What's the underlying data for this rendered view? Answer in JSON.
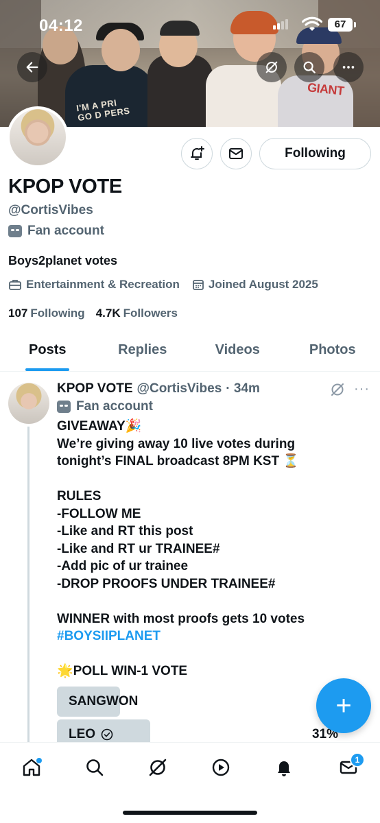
{
  "status_bar": {
    "time": "04:12",
    "battery": "67"
  },
  "banner": {
    "shirt_text": "I'M A PRI\nGO D PERS",
    "shirt_text_right": "GIANT"
  },
  "profile": {
    "name": "KPOP VOTE",
    "handle": "@CortisVibes",
    "label": "Fan account",
    "bio": "Boys2planet votes",
    "category": "Entertainment & Recreation",
    "joined": "Joined August 2025",
    "following_count": "107",
    "following_label": "Following",
    "followers_count": "4.7K",
    "followers_label": "Followers",
    "follow_button": "Following"
  },
  "tabs": [
    "Posts",
    "Replies",
    "Videos",
    "Photos"
  ],
  "post": {
    "name": "KPOP VOTE",
    "handle": "@CortisVibes",
    "time": "· 34m",
    "label": "Fan account",
    "more": "···",
    "lines": [
      "GIVEAWAY🎉",
      "We’re giving away 10 live votes during",
      "tonight’s FINAL broadcast 8PM KST ⏳",
      "",
      "RULES",
      "-FOLLOW ME",
      "-Like and RT this post",
      "-Like and RT ur TRAINEE#",
      "-Add pic of ur trainee",
      "-DROP PROOFS UNDER TRAINEE#",
      "",
      "WINNER with most proofs gets 10 votes"
    ],
    "hashtag": "#BOYSIIPLANET",
    "poll_title": "🌟POLL WIN-1 VOTE",
    "poll": [
      {
        "label": "SANGWON",
        "fraction": 0.21,
        "percent": ""
      },
      {
        "label": "LEO",
        "fraction": 0.31,
        "percent": "31%",
        "selected": true
      }
    ]
  },
  "fab": {
    "label": "+"
  },
  "bottom_nav": {
    "messages_badge": "1"
  },
  "colors": {
    "accent": "#1d9bf0",
    "text": "#0f1419",
    "muted": "#536471"
  }
}
